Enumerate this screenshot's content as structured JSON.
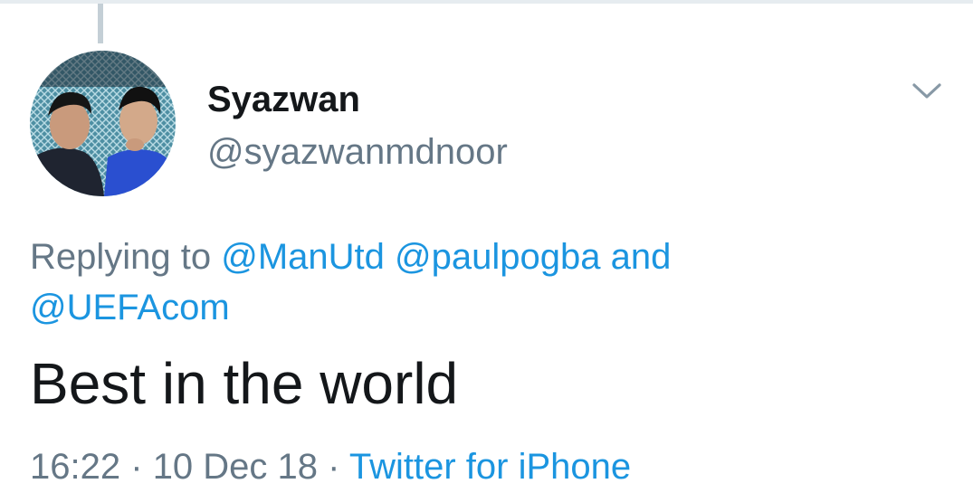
{
  "user": {
    "display_name": "Syazwan",
    "handle": "@syazwanmdnoor"
  },
  "reply": {
    "prefix": "Replying to",
    "mentions": [
      "@ManUtd",
      "@paulpogba",
      "@UEFAcom"
    ],
    "conjunction": "and"
  },
  "tweet": {
    "text": "Best in the world"
  },
  "meta": {
    "time": "16:22",
    "separator": "·",
    "date": "10 Dec 18",
    "source": "Twitter for iPhone"
  },
  "icons": {
    "menu": "chevron-down-icon"
  },
  "colors": {
    "link": "#1b95e0",
    "secondary_text": "#657786",
    "primary_text": "#14171a",
    "thread_line": "#c4cfd6"
  }
}
